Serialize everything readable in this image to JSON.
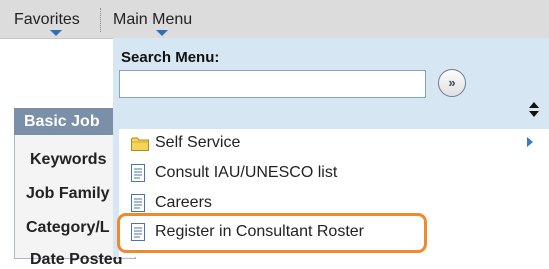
{
  "topbar": {
    "favorites_label": "Favorites",
    "main_menu_label": "Main Menu"
  },
  "background_page": {
    "section_header": "Basic Job",
    "labels": [
      "Keywords",
      "Job Family",
      "Category/L",
      "Date Posted"
    ]
  },
  "dropdown": {
    "search_label": "Search Menu:",
    "search_value": "",
    "go_glyph": "»",
    "items": [
      {
        "label": "Self Service",
        "icon": "folder-icon",
        "has_submenu": true
      },
      {
        "label": "Consult IAU/UNESCO list",
        "icon": "page-icon",
        "has_submenu": false
      },
      {
        "label": "Careers",
        "icon": "page-icon",
        "has_submenu": false
      },
      {
        "label": "Register in Consultant Roster",
        "icon": "page-icon",
        "has_submenu": false
      }
    ]
  },
  "colors": {
    "accent_arrow": "#2e6fb6",
    "dropdown_bg": "#d6e6f3",
    "highlight": "#f08a30"
  }
}
